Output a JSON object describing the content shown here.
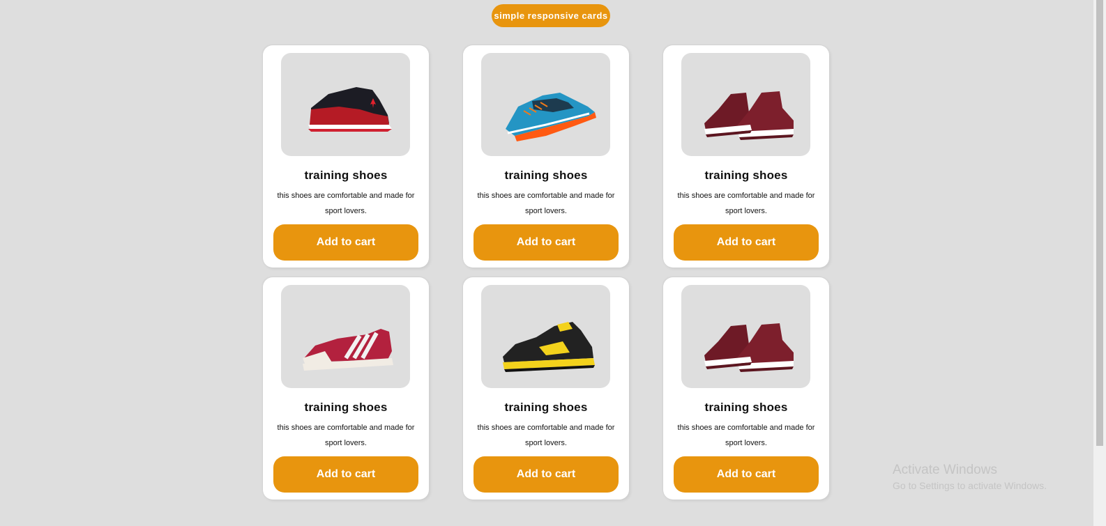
{
  "header": {
    "title": "simple responsive cards"
  },
  "cards": [
    {
      "title": "training shoes",
      "desc_line1": "this shoes are comfortable and made for",
      "desc_line2": "sport lovers.",
      "button_label": "Add to cart",
      "image": "black-red-basketball-sneaker"
    },
    {
      "title": "training shoes",
      "desc_line1": "this shoes are comfortable and made for",
      "desc_line2": "sport lovers.",
      "button_label": "Add to cart",
      "image": "blue-orange-running-sneaker"
    },
    {
      "title": "training shoes",
      "desc_line1": "this shoes are comfortable and made for",
      "desc_line2": "sport lovers.",
      "button_label": "Add to cart",
      "image": "burgundy-velvet-high-top-sneakers"
    },
    {
      "title": "training shoes",
      "desc_line1": "this shoes are comfortable and made for",
      "desc_line2": "sport lovers.",
      "button_label": "Add to cart",
      "image": "red-white-striped-sneaker"
    },
    {
      "title": "training shoes",
      "desc_line1": "this shoes are comfortable and made for",
      "desc_line2": "sport lovers.",
      "button_label": "Add to cart",
      "image": "black-yellow-basketball-sneaker"
    },
    {
      "title": "training shoes",
      "desc_line1": "this shoes are comfortable and made for",
      "desc_line2": "sport lovers.",
      "button_label": "Add to cart",
      "image": "burgundy-velvet-high-top-sneakers"
    }
  ],
  "watermark": {
    "line1": "Activate Windows",
    "line2": "Go to Settings to activate Windows."
  },
  "colors": {
    "background": "#dedede",
    "accent": "#e8950e",
    "card": "#ffffff"
  }
}
